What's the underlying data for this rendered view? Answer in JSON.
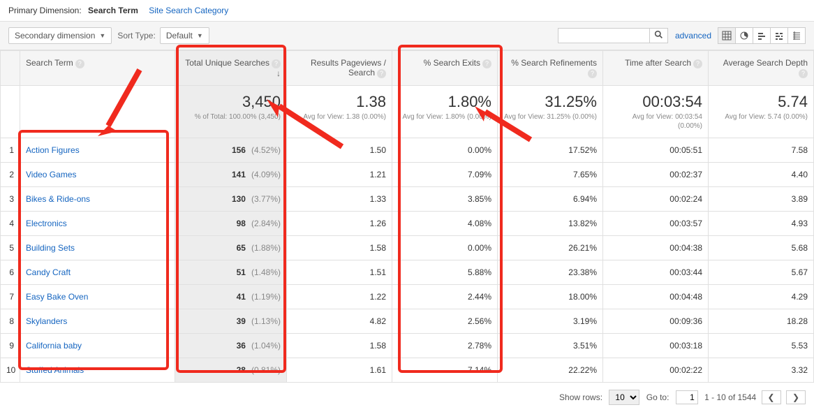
{
  "dimension": {
    "label": "Primary Dimension:",
    "value": "Search Term",
    "alt": "Site Search Category"
  },
  "toolbar": {
    "secondary": "Secondary dimension",
    "sortType": "Sort Type:",
    "defaultLabel": "Default",
    "advanced": "advanced",
    "searchPlaceholder": ""
  },
  "headers": {
    "term": "Search Term",
    "unique": "Total Unique Searches",
    "pageviews": "Results Pageviews / Search",
    "exits": "% Search Exits",
    "refine": "% Search Refinements",
    "time": "Time after Search",
    "depth": "Average Search Depth"
  },
  "summary": {
    "unique": {
      "v": "3,450",
      "sub": "% of Total: 100.00% (3,450)"
    },
    "pageviews": {
      "v": "1.38",
      "sub": "Avg for View: 1.38 (0.00%)"
    },
    "exits": {
      "v": "1.80%",
      "sub": "Avg for View: 1.80% (0.00%)"
    },
    "refine": {
      "v": "31.25%",
      "sub": "Avg for View: 31.25% (0.00%)"
    },
    "time": {
      "v": "00:03:54",
      "sub": "Avg for View: 00:03:54 (0.00%)"
    },
    "depth": {
      "v": "5.74",
      "sub": "Avg for View: 5.74 (0.00%)"
    }
  },
  "rows": [
    {
      "n": "1",
      "term": "Action Figures",
      "u": "156",
      "up": "(4.52%)",
      "pv": "1.50",
      "ex": "0.00%",
      "rf": "17.52%",
      "ti": "00:05:51",
      "dp": "7.58"
    },
    {
      "n": "2",
      "term": "Video Games",
      "u": "141",
      "up": "(4.09%)",
      "pv": "1.21",
      "ex": "7.09%",
      "rf": "7.65%",
      "ti": "00:02:37",
      "dp": "4.40"
    },
    {
      "n": "3",
      "term": "Bikes & Ride-ons",
      "u": "130",
      "up": "(3.77%)",
      "pv": "1.33",
      "ex": "3.85%",
      "rf": "6.94%",
      "ti": "00:02:24",
      "dp": "3.89"
    },
    {
      "n": "4",
      "term": "Electronics",
      "u": "98",
      "up": "(2.84%)",
      "pv": "1.26",
      "ex": "4.08%",
      "rf": "13.82%",
      "ti": "00:03:57",
      "dp": "4.93"
    },
    {
      "n": "5",
      "term": "Building Sets",
      "u": "65",
      "up": "(1.88%)",
      "pv": "1.58",
      "ex": "0.00%",
      "rf": "26.21%",
      "ti": "00:04:38",
      "dp": "5.68"
    },
    {
      "n": "6",
      "term": "Candy Craft",
      "u": "51",
      "up": "(1.48%)",
      "pv": "1.51",
      "ex": "5.88%",
      "rf": "23.38%",
      "ti": "00:03:44",
      "dp": "5.67"
    },
    {
      "n": "7",
      "term": "Easy Bake Oven",
      "u": "41",
      "up": "(1.19%)",
      "pv": "1.22",
      "ex": "2.44%",
      "rf": "18.00%",
      "ti": "00:04:48",
      "dp": "4.29"
    },
    {
      "n": "8",
      "term": "Skylanders",
      "u": "39",
      "up": "(1.13%)",
      "pv": "4.82",
      "ex": "2.56%",
      "rf": "3.19%",
      "ti": "00:09:36",
      "dp": "18.28"
    },
    {
      "n": "9",
      "term": "California baby",
      "u": "36",
      "up": "(1.04%)",
      "pv": "1.58",
      "ex": "2.78%",
      "rf": "3.51%",
      "ti": "00:03:18",
      "dp": "5.53"
    },
    {
      "n": "10",
      "term": "Stuffed Animals",
      "u": "28",
      "up": "(0.81%)",
      "pv": "1.61",
      "ex": "7.14%",
      "rf": "22.22%",
      "ti": "00:02:22",
      "dp": "3.32"
    }
  ],
  "pager": {
    "showRows": "Show rows:",
    "rowsVal": "10",
    "goTo": "Go to:",
    "goVal": "1",
    "range": "1 - 10 of 1544",
    "prev": "❮",
    "next": "❯"
  }
}
